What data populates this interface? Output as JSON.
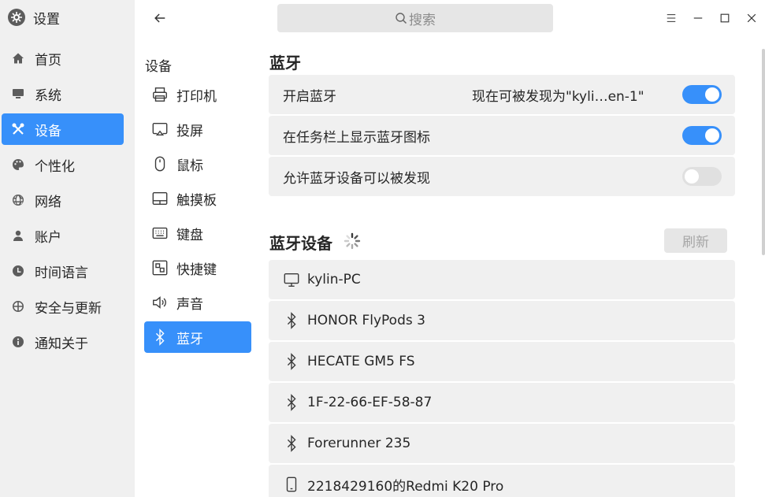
{
  "app": {
    "title": "设置"
  },
  "sidebar": {
    "items": [
      {
        "label": "首页",
        "icon": "home-icon"
      },
      {
        "label": "系统",
        "icon": "monitor-icon"
      },
      {
        "label": "设备",
        "icon": "tools-icon",
        "active": true
      },
      {
        "label": "个性化",
        "icon": "palette-icon"
      },
      {
        "label": "网络",
        "icon": "globe-icon"
      },
      {
        "label": "账户",
        "icon": "user-icon"
      },
      {
        "label": "时间语言",
        "icon": "clock-icon"
      },
      {
        "label": "安全与更新",
        "icon": "shield-icon"
      },
      {
        "label": "通知关于",
        "icon": "info-icon"
      }
    ]
  },
  "search": {
    "placeholder": "搜索"
  },
  "subnav": {
    "title": "设备",
    "items": [
      {
        "label": "打印机",
        "icon": "printer-icon"
      },
      {
        "label": "投屏",
        "icon": "cast-icon"
      },
      {
        "label": "鼠标",
        "icon": "mouse-icon"
      },
      {
        "label": "触摸板",
        "icon": "touchpad-icon"
      },
      {
        "label": "键盘",
        "icon": "keyboard-icon"
      },
      {
        "label": "快捷键",
        "icon": "shortcut-icon"
      },
      {
        "label": "声音",
        "icon": "speaker-icon"
      },
      {
        "label": "蓝牙",
        "icon": "bluetooth-icon",
        "active": true
      }
    ]
  },
  "bluetooth": {
    "title": "蓝牙",
    "settings": [
      {
        "label": "开启蓝牙",
        "hint": "现在可被发现为\"kyli…en-1\"",
        "enabled": true
      },
      {
        "label": "在任务栏上显示蓝牙图标",
        "hint": "",
        "enabled": true
      },
      {
        "label": "允许蓝牙设备可以被发现",
        "hint": "",
        "enabled": false
      }
    ],
    "devices_title": "蓝牙设备",
    "refresh_label": "刷新",
    "devices": [
      {
        "name": "kylin-PC",
        "icon": "computer-icon"
      },
      {
        "name": "HONOR FlyPods 3",
        "icon": "bluetooth-icon"
      },
      {
        "name": "HECATE GM5 FS",
        "icon": "bluetooth-icon"
      },
      {
        "name": "1F-22-66-EF-58-87",
        "icon": "bluetooth-icon"
      },
      {
        "name": "Forerunner 235",
        "icon": "bluetooth-icon"
      },
      {
        "name": "2218429160的Redmi K20 Pro",
        "icon": "phone-icon"
      }
    ]
  },
  "colors": {
    "accent": "#3790fa",
    "sidebar_bg": "#f0f0f0",
    "row_bg": "#f0f0f0"
  }
}
